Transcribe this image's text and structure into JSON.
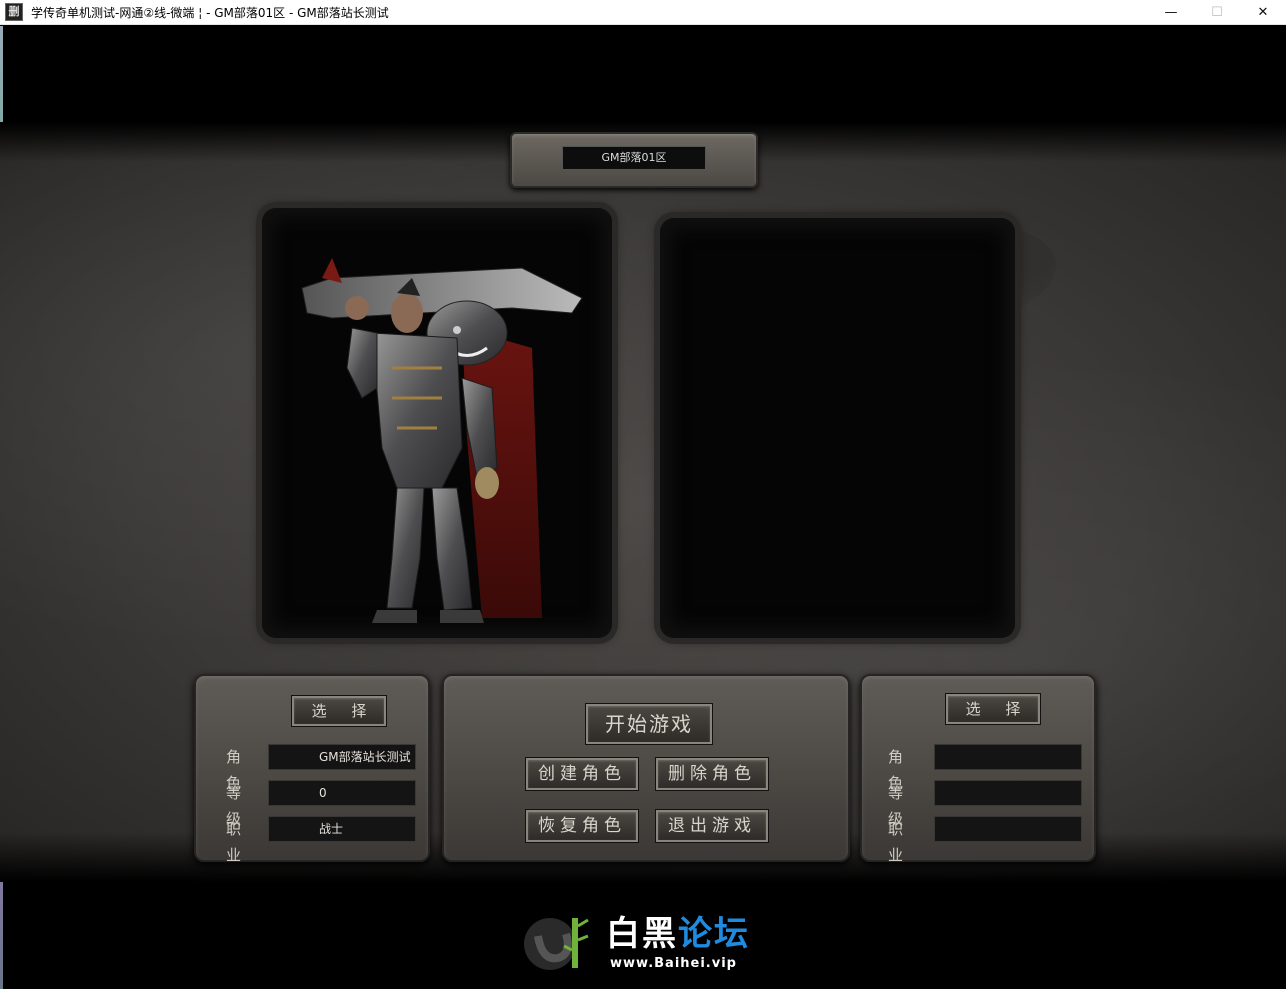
{
  "window": {
    "app_icon_glyph": "删",
    "title": "学传奇单机测试-网通②线-微端 ¦ - GM部落01区 - GM部落站长测试",
    "minimize_glyph": "—",
    "maximize_glyph": "☐",
    "close_glyph": "✕"
  },
  "server": {
    "name": "GM部落01区"
  },
  "slot_left": {
    "select_label": "选 择",
    "labels": {
      "role": "角色",
      "level": "等级",
      "job": "职业"
    },
    "values": {
      "role": "GM部落站长测试",
      "level": "0",
      "job": "战士"
    }
  },
  "slot_right": {
    "select_label": "选 择",
    "labels": {
      "role": "角色",
      "level": "等级",
      "job": "职业"
    },
    "values": {
      "role": "",
      "level": "",
      "job": ""
    }
  },
  "actions": {
    "start": "开始游戏",
    "create": "创建角色",
    "delete": "删除角色",
    "restore": "恢复角色",
    "quit": "退出游戏"
  },
  "watermark": {
    "title_part1": "白黑",
    "title_part2": "论坛",
    "url": "www.Baihei.vip"
  },
  "colors": {
    "watermark_accent": "#1f8be0",
    "stone": "#4a4642"
  },
  "icons": {
    "app": "app-icon",
    "character": "warrior-portrait"
  }
}
